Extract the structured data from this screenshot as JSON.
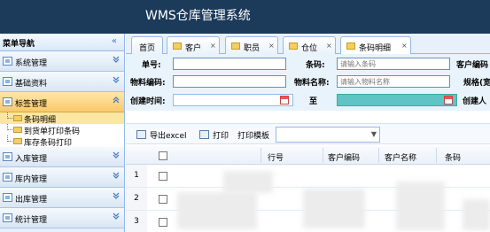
{
  "header": {
    "title": "WMS仓库管理系统"
  },
  "sidebar": {
    "title": "菜单导航",
    "collapse_icon": "«",
    "menus": [
      {
        "label": "系统管理",
        "icon": "menu-icon",
        "state": "collapsed"
      },
      {
        "label": "基础资料",
        "icon": "menu-icon",
        "state": "collapsed"
      },
      {
        "label": "标签管理",
        "icon": "menu-icon",
        "state": "expanded"
      },
      {
        "label": "入库管理",
        "icon": "menu-icon",
        "state": "collapsed"
      },
      {
        "label": "库内管理",
        "icon": "menu-icon",
        "state": "collapsed"
      },
      {
        "label": "出库管理",
        "icon": "menu-icon",
        "state": "collapsed"
      },
      {
        "label": "统计管理",
        "icon": "menu-icon",
        "state": "collapsed"
      }
    ],
    "submenu": [
      "条码明细",
      "到货单打印条码",
      "库存条码打印"
    ],
    "chevron_down": "»",
    "chevron_up": "«"
  },
  "tabs": [
    {
      "label": "首页",
      "closable": false
    },
    {
      "label": "客户",
      "closable": true
    },
    {
      "label": "职员",
      "closable": true
    },
    {
      "label": "仓位",
      "closable": true
    },
    {
      "label": "条码明细",
      "closable": true,
      "active": true
    }
  ],
  "tab_close": "×",
  "form": {
    "order_no_label": "单号:",
    "barcode_label": "条码:",
    "barcode_placeholder": "请输入条码",
    "customer_code_label": "客户编码",
    "material_code_label": "物料编码:",
    "material_name_label": "物料名称:",
    "material_name_placeholder": "请输入物料名称",
    "spec_label": "规格(宽",
    "created_time_label": "创建时间:",
    "to_label": "至",
    "creator_label": "创建人"
  },
  "toolbar": {
    "export_label": "导出excel",
    "print_label": "打印",
    "print_template_label": "打印模板",
    "dropdown_arrow": "▼"
  },
  "grid": {
    "columns": [
      "行号",
      "客户编码",
      "客户名称",
      "条码"
    ],
    "rows": [
      "1",
      "2",
      "3"
    ]
  },
  "colors": {
    "header_bg": "#1c3a5a",
    "active_menu": "#f9c96a",
    "accent": "#95b8e7"
  }
}
